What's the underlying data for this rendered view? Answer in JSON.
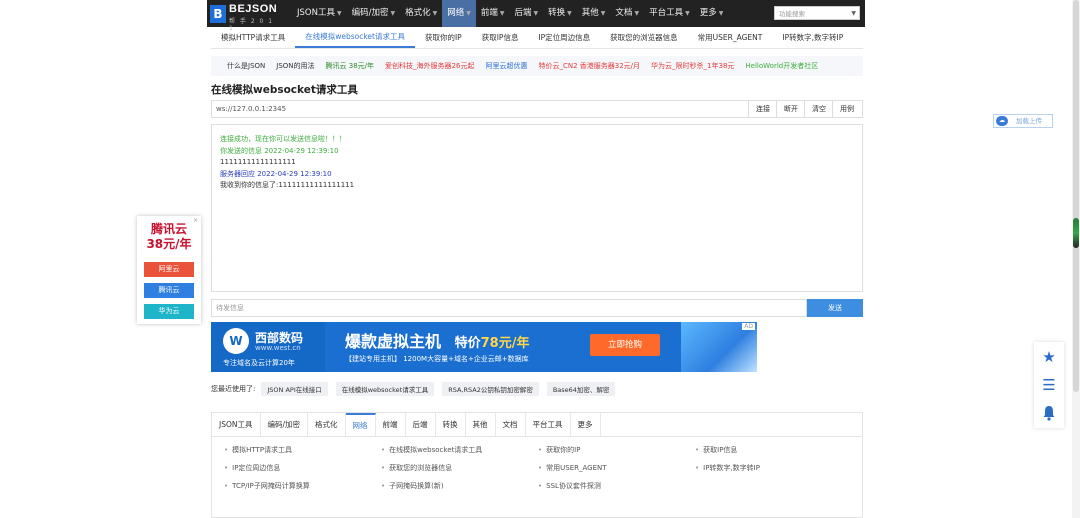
{
  "header": {
    "logo_mark": "B",
    "logo_text": "BEJSON",
    "logo_sub": "帮 手 2 0 1 1",
    "nav": [
      {
        "label": "JSON工具",
        "active": false
      },
      {
        "label": "编码/加密",
        "active": false
      },
      {
        "label": "格式化",
        "active": false
      },
      {
        "label": "网络",
        "active": true
      },
      {
        "label": "前端",
        "active": false
      },
      {
        "label": "后端",
        "active": false
      },
      {
        "label": "转换",
        "active": false
      },
      {
        "label": "其他",
        "active": false
      },
      {
        "label": "文档",
        "active": false
      },
      {
        "label": "平台工具",
        "active": false
      },
      {
        "label": "更多",
        "active": false
      }
    ],
    "search_placeholder": "功能搜索"
  },
  "subnav": [
    {
      "label": "模拟HTTP请求工具",
      "active": false
    },
    {
      "label": "在线模拟websocket请求工具",
      "active": true
    },
    {
      "label": "获取你的IP",
      "active": false
    },
    {
      "label": "获取IP信息",
      "active": false
    },
    {
      "label": "IP定位周边信息",
      "active": false
    },
    {
      "label": "获取您的浏览器信息",
      "active": false
    },
    {
      "label": "常用USER_AGENT",
      "active": false
    },
    {
      "label": "IP转数字,数字转IP",
      "active": false
    }
  ],
  "adbar": [
    {
      "label": "什么是JSON",
      "color": "#333333"
    },
    {
      "label": "JSON的用法",
      "color": "#333333"
    },
    {
      "label": "腾讯云 38元/年",
      "color": "#2a8a2a"
    },
    {
      "label": "爱创科技_海外服务器26元起",
      "color": "#e23b3b"
    },
    {
      "label": "阿里云超优惠",
      "color": "#2a6fd6"
    },
    {
      "label": "特价云_CN2 香港服务器32元/月",
      "color": "#e23b3b"
    },
    {
      "label": "华为云_限时秒杀_1年38元",
      "color": "#e23b3b"
    },
    {
      "label": "HelloWorld开发者社区",
      "color": "#3cae3c"
    }
  ],
  "page_title": "在线模拟websocket请求工具",
  "url": {
    "value": "ws://127.0.0.1:2345",
    "buttons": [
      "连接",
      "断开",
      "清空",
      "用例"
    ]
  },
  "output": [
    {
      "text": "连接成功，现在你可以发送信息啦！！！",
      "color": "green"
    },
    {
      "text": "你发送的信息 2022-04-29 12:39:10",
      "color": "green"
    },
    {
      "text": "11111111111111111",
      "color": "dark"
    },
    {
      "text": "服务器回应 2022-04-29 12:39:10",
      "color": "blue"
    },
    {
      "text": "我收到你的信息了:11111111111111111",
      "color": "dark"
    }
  ],
  "send": {
    "placeholder": "待发信息",
    "button": "发送"
  },
  "banner": {
    "logo_glyph": "W",
    "brand": "西部数码",
    "url": "www.west.cn",
    "slogan": "专注域名及云计算20年",
    "headline": "爆款虚拟主机",
    "price_prefix": "特价",
    "price": "78元/年",
    "subline": "【建站专用主机】 1200M大容量+域名+企业云邮+数据库",
    "button": "立即抢购",
    "ad_mark": "AD"
  },
  "recent": {
    "label": "您最近使用了:",
    "tags": [
      "JSON API在线接口",
      "在线模拟websocket请求工具",
      "RSA,RSA2公钥私钥加密解密",
      "Base64加密、解密"
    ]
  },
  "tabs": [
    {
      "label": "JSON工具",
      "active": false
    },
    {
      "label": "编码/加密",
      "active": false
    },
    {
      "label": "格式化",
      "active": false
    },
    {
      "label": "网络",
      "active": true
    },
    {
      "label": "前端",
      "active": false
    },
    {
      "label": "后端",
      "active": false
    },
    {
      "label": "转换",
      "active": false
    },
    {
      "label": "其他",
      "active": false
    },
    {
      "label": "文档",
      "active": false
    },
    {
      "label": "平台工具",
      "active": false
    },
    {
      "label": "更多",
      "active": false
    }
  ],
  "tab_links": [
    "模拟HTTP请求工具",
    "在线模拟websocket请求工具",
    "获取你的IP",
    "获取IP信息",
    "IP定位周边信息",
    "获取您的浏览器信息",
    "常用USER_AGENT",
    "IP转数字,数字转IP",
    "TCP/IP子网掩码计算换算",
    "子网掩码换算(新)",
    "SSL协议套件探测"
  ],
  "left_ad": {
    "title_line1": "腾讯云",
    "title_line2": "38元/年",
    "close": "×",
    "buttons": [
      {
        "label": "阿里云",
        "color": "#e8533a"
      },
      {
        "label": "腾讯云",
        "color": "#2f7fe0"
      },
      {
        "label": "华为云",
        "color": "#1fb5c9"
      }
    ]
  },
  "share": {
    "label": "加载上传"
  },
  "side_tools": [
    "star-icon",
    "menu-icon",
    "bell-icon"
  ]
}
